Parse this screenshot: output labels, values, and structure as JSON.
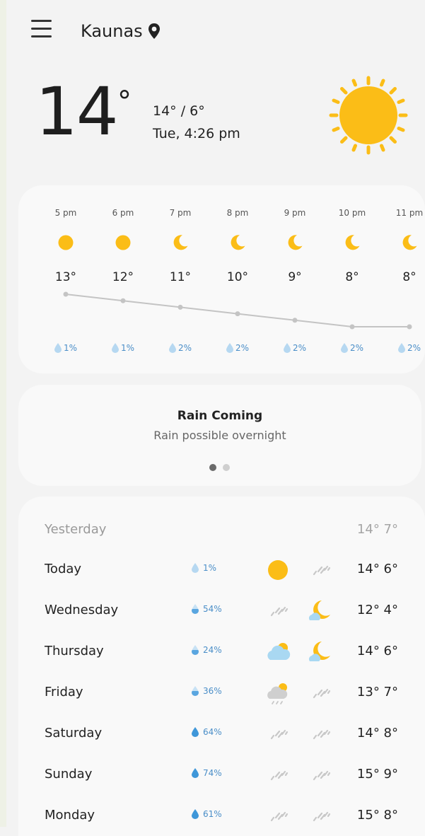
{
  "header": {
    "city": "Kaunas"
  },
  "current": {
    "temp": "14",
    "degree_symbol": "°",
    "hi_lo": "14° / 6°",
    "datetime": "Tue, 4:26 pm",
    "icon": "sun-icon"
  },
  "hourly": [
    {
      "time": "5 pm",
      "temp": "13°",
      "rain": "1%",
      "icon": "sun"
    },
    {
      "time": "6 pm",
      "temp": "12°",
      "rain": "1%",
      "icon": "sun"
    },
    {
      "time": "7 pm",
      "temp": "11°",
      "rain": "2%",
      "icon": "moon"
    },
    {
      "time": "8 pm",
      "temp": "10°",
      "rain": "2%",
      "icon": "moon"
    },
    {
      "time": "9 pm",
      "temp": "9°",
      "rain": "2%",
      "icon": "moon"
    },
    {
      "time": "10 pm",
      "temp": "8°",
      "rain": "2%",
      "icon": "moon"
    },
    {
      "time": "11 pm",
      "temp": "8°",
      "rain": "2%",
      "icon": "moon"
    }
  ],
  "alert": {
    "title": "Rain Coming",
    "subtitle": "Rain possible overnight",
    "pages": 2,
    "active_page": 1
  },
  "daily": {
    "yesterday": {
      "label": "Yesterday",
      "temps": "14° 7°"
    },
    "days": [
      {
        "name": "Today",
        "rain": "1%",
        "day_icon": "sun",
        "night_icon": "rain",
        "temps": "14° 6°"
      },
      {
        "name": "Wednesday",
        "rain": "54%",
        "day_icon": "rain",
        "night_icon": "moon-cloud",
        "temps": "12° 4°"
      },
      {
        "name": "Thursday",
        "rain": "24%",
        "day_icon": "cloud-sun",
        "night_icon": "moon-cloud",
        "temps": "14° 6°"
      },
      {
        "name": "Friday",
        "rain": "36%",
        "day_icon": "cloud-sun-rain",
        "night_icon": "rain",
        "temps": "13° 7°"
      },
      {
        "name": "Saturday",
        "rain": "64%",
        "day_icon": "rain",
        "night_icon": "rain",
        "temps": "14° 8°"
      },
      {
        "name": "Sunday",
        "rain": "74%",
        "day_icon": "rain",
        "night_icon": "rain",
        "temps": "15° 9°"
      },
      {
        "name": "Monday",
        "rain": "61%",
        "day_icon": "rain",
        "night_icon": "rain",
        "temps": "15° 8°"
      }
    ]
  },
  "colors": {
    "background": "#f3f3f3",
    "card": "#f9f9f9",
    "sun": "#fbbd17",
    "rain_drop": "#9cc8ea",
    "rain_text": "#4a8ec8",
    "line": "#c4c4c4",
    "cloud": "#a9d8f2"
  }
}
